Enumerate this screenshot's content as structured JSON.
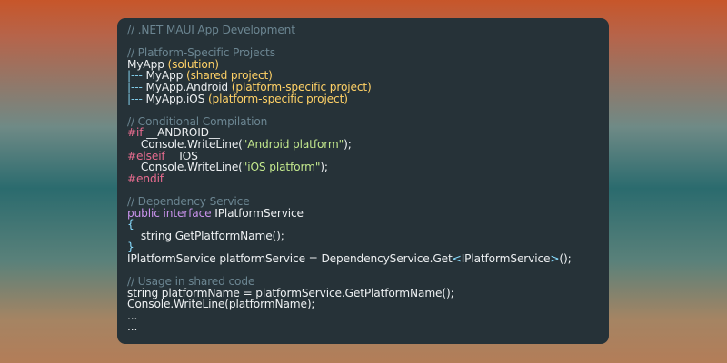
{
  "code": {
    "title_comment": "// .NET MAUI App Development",
    "section1": {
      "comment": "// Platform-Specific Projects",
      "root": "MyApp",
      "root_note": "(solution)",
      "items": [
        {
          "prefix": "|--- ",
          "name": "MyApp",
          "note": "(shared project)"
        },
        {
          "prefix": "|--- ",
          "name": "MyApp.Android",
          "note": "(platform-specific project)"
        },
        {
          "prefix": "|--- ",
          "name": "MyApp.iOS",
          "note": "(platform-specific project)"
        }
      ]
    },
    "section2": {
      "comment": "// Conditional Compilation",
      "if_directive": "#if",
      "android_symbol": "__ANDROID__",
      "console_call_1": "Console.WriteLine(",
      "android_string": "\"Android platform\"",
      "call_end_1": ");",
      "elseif_directive": "#elseif",
      "ios_symbol": "__IOS__",
      "console_call_2": "Console.WriteLine(",
      "ios_string": "\"iOS platform\"",
      "call_end_2": ");",
      "endif_directive": "#endif"
    },
    "section3": {
      "comment": "// Dependency Service",
      "keyword_public": "public",
      "keyword_interface": "interface",
      "interface_name": "IPlatformService",
      "open_brace": "{",
      "method_signature": "string GetPlatformName",
      "method_parens": "();",
      "close_brace": "}",
      "assign_lhs": "IPlatformService platformService = DependencyService.Get",
      "generic_open": "<",
      "generic_type": "IPlatformService",
      "generic_close": ">",
      "assign_end": "();"
    },
    "section4": {
      "comment": "// Usage in shared code",
      "line1_lhs": "string platformName = platformService.GetPlatformName",
      "line1_end": "();",
      "line2_call": "Console.WriteLine",
      "line2_args": "(platformName);",
      "ellipsis_1": "...",
      "ellipsis_2": "..."
    }
  },
  "colors": {
    "panel_background": "#263238",
    "comment": "#6b8591",
    "keyword": "#c792ea",
    "string": "#c3e88d",
    "directive": "#e56b8e",
    "punctuation": "#89ddff"
  }
}
